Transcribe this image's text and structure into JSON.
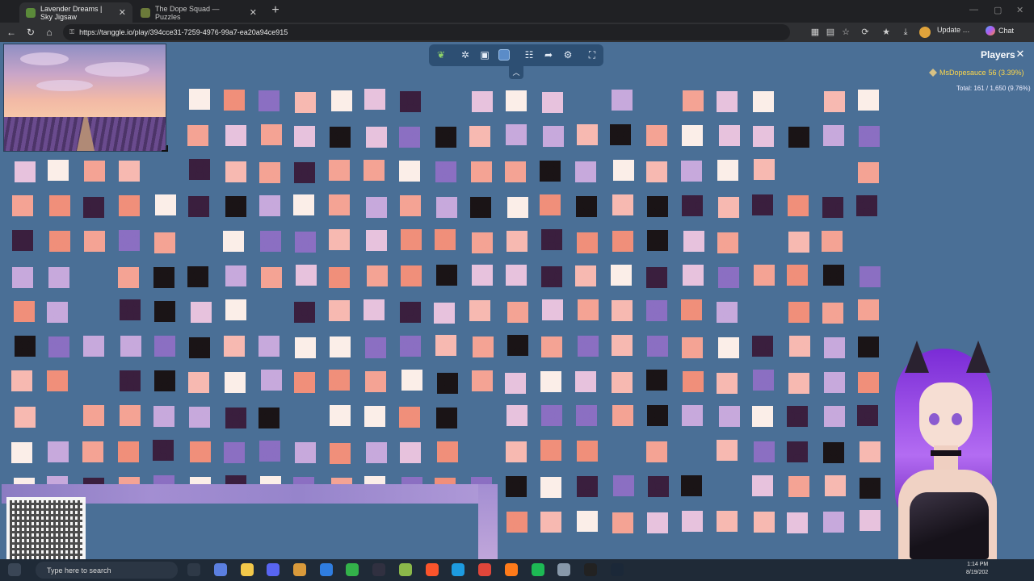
{
  "browser": {
    "tabs": [
      {
        "label": "Lavender Dreams | Sky Jigsaw",
        "active": true
      },
      {
        "label": "The Dope Squad — Puzzles",
        "active": false
      }
    ],
    "url": "https://tanggle.io/play/394cce31-7259-4976-99a7-ea20a94ce915",
    "update_label": "Update",
    "chat_label": "Chat"
  },
  "game": {
    "players_title": "Players",
    "player": {
      "name": "MsDopesauce",
      "score": "56 (3.39%)"
    },
    "total": "Total: 161 / 1,650 (9.76%)"
  },
  "taskbar": {
    "search_placeholder": "Type here to search",
    "time": "1:14 PM",
    "date": "8/19/202"
  },
  "colors": {
    "game_bg": "#4a6f96",
    "player_name": "#ffd84a",
    "piece_palette": [
      "#f4a394",
      "#f7b9b1",
      "#fbeee8",
      "#c7a9dc",
      "#8b6fc2",
      "#3a1f3e",
      "#1a1416",
      "#f08f7a",
      "#e7c2dd"
    ]
  }
}
